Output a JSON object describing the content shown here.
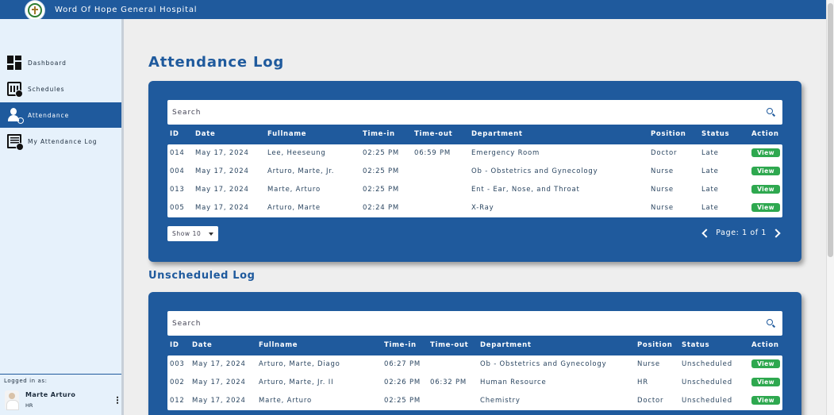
{
  "header": {
    "title": "Word Of Hope General Hospital"
  },
  "sidebar": {
    "items": [
      {
        "label": "Dashboard",
        "icon": "dashboard-icon",
        "active": false
      },
      {
        "label": "Schedules",
        "icon": "calendar-clock-icon",
        "active": false
      },
      {
        "label": "Attendance",
        "icon": "person-check-icon",
        "active": true
      },
      {
        "label": "My Attendance Log",
        "icon": "log-clock-icon",
        "active": false
      }
    ],
    "logged_in_label": "Logged in as:",
    "user": {
      "name": "Marte Arturo",
      "role": "HR"
    }
  },
  "main": {
    "title": "Attendance Log",
    "attendance": {
      "search_placeholder": "Search",
      "columns": [
        "ID",
        "Date",
        "Fullname",
        "Time-in",
        "Time-out",
        "Department",
        "Position",
        "Status",
        "Action"
      ],
      "rows": [
        {
          "id": "014",
          "date": "May 17, 2024",
          "fullname": "Lee, Heeseung",
          "time_in": "02:25 PM",
          "time_out": "06:59 PM",
          "department": "Emergency Room",
          "position": "Doctor",
          "status": "Late",
          "action": "View"
        },
        {
          "id": "004",
          "date": "May 17, 2024",
          "fullname": "Arturo, Marte, Jr.",
          "time_in": "02:25 PM",
          "time_out": "",
          "department": "Ob - Obstetrics and Gynecology",
          "position": "Nurse",
          "status": "Late",
          "action": "View"
        },
        {
          "id": "013",
          "date": "May 17, 2024",
          "fullname": "Marte, Arturo",
          "time_in": "02:25 PM",
          "time_out": "",
          "department": "Ent - Ear, Nose, and Throat",
          "position": "Nurse",
          "status": "Late",
          "action": "View"
        },
        {
          "id": "005",
          "date": "May 17, 2024",
          "fullname": "Arturo, Marte",
          "time_in": "02:24 PM",
          "time_out": "",
          "department": "X-Ray",
          "position": "Nurse",
          "status": "Late",
          "action": "View"
        }
      ],
      "show_select": "Show 10",
      "pager": "Page: 1 of 1"
    },
    "unscheduled": {
      "title": "Unscheduled Log",
      "search_placeholder": "Search",
      "columns": [
        "ID",
        "Date",
        "Fullname",
        "Time-in",
        "Time-out",
        "Department",
        "Position",
        "Status",
        "Action"
      ],
      "rows": [
        {
          "id": "003",
          "date": "May 17, 2024",
          "fullname": "Arturo, Marte, Diago",
          "time_in": "06:27 PM",
          "time_out": "",
          "department": "Ob - Obstetrics and Gynecology",
          "position": "Nurse",
          "status": "Unscheduled",
          "action": "View"
        },
        {
          "id": "002",
          "date": "May 17, 2024",
          "fullname": "Arturo, Marte, Jr. II",
          "time_in": "02:26 PM",
          "time_out": "06:32 PM",
          "department": "Human Resource",
          "position": "HR",
          "status": "Unscheduled",
          "action": "View"
        },
        {
          "id": "012",
          "date": "May 17, 2024",
          "fullname": "Marte, Arturo",
          "time_in": "02:25 PM",
          "time_out": "",
          "department": "Chemistry",
          "position": "Doctor",
          "status": "Unscheduled",
          "action": "View"
        }
      ]
    }
  },
  "colors": {
    "primary": "#1f5a9d",
    "sidebar_bg": "#e6f1fb",
    "view_button": "#2ea84f",
    "page_bg": "#eeeeee"
  }
}
